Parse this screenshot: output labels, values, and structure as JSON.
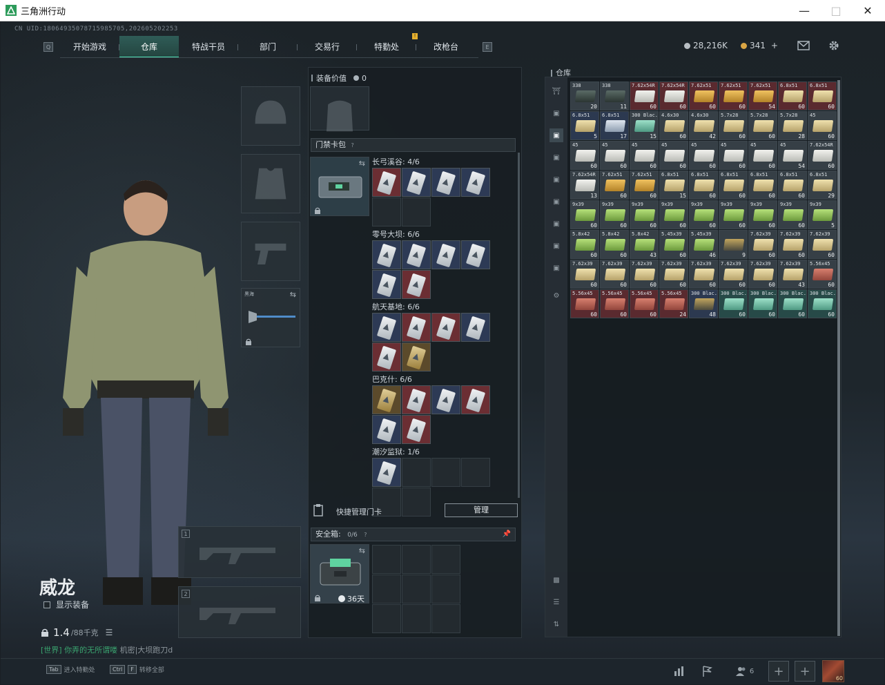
{
  "window": {
    "title": "三角洲行动",
    "controls": [
      "minimize",
      "maximize",
      "close"
    ]
  },
  "uid": "CN UID:18064935078715985705,202605202253",
  "nav": {
    "left_key": "Q",
    "right_key": "E",
    "tabs": [
      "开始游戏",
      "仓库",
      "特战干员",
      "部门",
      "交易行",
      "特勤处",
      "改枪台"
    ],
    "active": "仓库"
  },
  "currency": {
    "coins": "28,216K",
    "bonds": "341",
    "plus": "+"
  },
  "character": {
    "name": "威龙",
    "show_equipment": "显示装备",
    "weight_value": "1.4",
    "weight_max": "/88千克",
    "chat_channel": "[世界]",
    "chat_author": "你弄的无所谓喽",
    "chat_message": "机密|大坝跑刀d"
  },
  "equipment": {
    "melee_label": "黑海",
    "weapon_slot_1": "1",
    "weapon_slot_2": "2"
  },
  "gear_value": {
    "label": "装备价值",
    "value": "0"
  },
  "keycard_pack": {
    "title": "门禁卡包",
    "groups": [
      {
        "label": "长弓溪谷: 4/6",
        "cards": [
          "red",
          "navy",
          "navy",
          "navy",
          "empty",
          "empty"
        ]
      },
      {
        "label": "零号大坝: 6/6",
        "cards": [
          "navy",
          "navy",
          "navy",
          "navy",
          "navy",
          "red"
        ]
      },
      {
        "label": "航天基地: 6/6",
        "cards": [
          "navy",
          "red",
          "red",
          "navy",
          "red",
          "gold"
        ]
      },
      {
        "label": "巴克什: 6/6",
        "cards": [
          "gold",
          "red",
          "navy",
          "red",
          "navy",
          "red"
        ]
      },
      {
        "label": "潮汐监狱: 1/6",
        "cards": [
          "navy",
          "empty",
          "empty",
          "empty",
          "empty",
          "empty"
        ]
      }
    ],
    "quick_manage": "快捷管理门卡",
    "manage_button": "管理"
  },
  "safe_box": {
    "label": "安全箱:",
    "capacity": "0/6",
    "timer": "36天"
  },
  "warehouse": {
    "title": "仓库",
    "items": [
      {
        "cal": "338",
        "cnt": "20",
        "tile": "gray",
        "box": "dark"
      },
      {
        "cal": "338",
        "cnt": "11",
        "tile": "gray",
        "box": "dark"
      },
      {
        "cal": "7.62x54R",
        "cnt": "60",
        "tile": "red",
        "box": "white"
      },
      {
        "cal": "7.62x54R",
        "cnt": "60",
        "tile": "red",
        "box": "white"
      },
      {
        "cal": "7.62x51",
        "cnt": "60",
        "tile": "red",
        "box": "orange"
      },
      {
        "cal": "7.62x51",
        "cnt": "60",
        "tile": "red",
        "box": "orange"
      },
      {
        "cal": "7.62x51",
        "cnt": "54",
        "tile": "red",
        "box": "orange"
      },
      {
        "cal": "6.8x51",
        "cnt": "60",
        "tile": "red",
        "box": "tan"
      },
      {
        "cal": "6.8x51",
        "cnt": "60",
        "tile": "red",
        "box": "tan"
      },
      {
        "cal": "6.8x51",
        "cnt": "5",
        "tile": "navy",
        "box": "tan"
      },
      {
        "cal": "6.8x51",
        "cnt": "17",
        "tile": "navy",
        "box": "blue"
      },
      {
        "cal": "300 Blac.",
        "cnt": "15",
        "tile": "gray",
        "box": "teal"
      },
      {
        "cal": "4.6x30",
        "cnt": "60",
        "tile": "gray",
        "box": "tan"
      },
      {
        "cal": "4.6x30",
        "cnt": "42",
        "tile": "gray",
        "box": "tan"
      },
      {
        "cal": "5.7x28",
        "cnt": "60",
        "tile": "gray",
        "box": "tan"
      },
      {
        "cal": "5.7x28",
        "cnt": "60",
        "tile": "gray",
        "box": "tan"
      },
      {
        "cal": "5.7x28",
        "cnt": "28",
        "tile": "gray",
        "box": "tan"
      },
      {
        "cal": "45",
        "cnt": "60",
        "tile": "gray",
        "box": "tan"
      },
      {
        "cal": "45",
        "cnt": "60",
        "tile": "gray",
        "box": "white"
      },
      {
        "cal": "45",
        "cnt": "60",
        "tile": "gray",
        "box": "white"
      },
      {
        "cal": "45",
        "cnt": "60",
        "tile": "gray",
        "box": "white"
      },
      {
        "cal": "45",
        "cnt": "60",
        "tile": "gray",
        "box": "white"
      },
      {
        "cal": "45",
        "cnt": "60",
        "tile": "gray",
        "box": "white"
      },
      {
        "cal": "45",
        "cnt": "60",
        "tile": "gray",
        "box": "white"
      },
      {
        "cal": "45",
        "cnt": "60",
        "tile": "gray",
        "box": "white"
      },
      {
        "cal": "45",
        "cnt": "54",
        "tile": "gray",
        "box": "white"
      },
      {
        "cal": "7.62x54R",
        "cnt": "60",
        "tile": "gray",
        "box": "white"
      },
      {
        "cal": "7.62x54R",
        "cnt": "13",
        "tile": "gray",
        "box": "white"
      },
      {
        "cal": "7.62x51",
        "cnt": "60",
        "tile": "gray",
        "box": "orange"
      },
      {
        "cal": "7.62x51",
        "cnt": "60",
        "tile": "gray",
        "box": "orange"
      },
      {
        "cal": "6.8x51",
        "cnt": "15",
        "tile": "gray",
        "box": "tan"
      },
      {
        "cal": "6.8x51",
        "cnt": "60",
        "tile": "gray",
        "box": "tan"
      },
      {
        "cal": "6.8x51",
        "cnt": "60",
        "tile": "gray",
        "box": "tan"
      },
      {
        "cal": "6.8x51",
        "cnt": "60",
        "tile": "gray",
        "box": "tan"
      },
      {
        "cal": "6.8x51",
        "cnt": "60",
        "tile": "gray",
        "box": "tan"
      },
      {
        "cal": "6.8x51",
        "cnt": "29",
        "tile": "gray",
        "box": "tan"
      },
      {
        "cal": "9x39",
        "cnt": "60",
        "tile": "gray",
        "box": "green"
      },
      {
        "cal": "9x39",
        "cnt": "60",
        "tile": "gray",
        "box": "green"
      },
      {
        "cal": "9x39",
        "cnt": "60",
        "tile": "gray",
        "box": "green"
      },
      {
        "cal": "9x39",
        "cnt": "60",
        "tile": "gray",
        "box": "green"
      },
      {
        "cal": "9x39",
        "cnt": "60",
        "tile": "gray",
        "box": "green"
      },
      {
        "cal": "9x39",
        "cnt": "60",
        "tile": "gray",
        "box": "green"
      },
      {
        "cal": "9x39",
        "cnt": "60",
        "tile": "gray",
        "box": "green"
      },
      {
        "cal": "9x39",
        "cnt": "60",
        "tile": "gray",
        "box": "green"
      },
      {
        "cal": "9x39",
        "cnt": "5",
        "tile": "gray",
        "box": "green"
      },
      {
        "cal": "5.8x42",
        "cnt": "60",
        "tile": "gray",
        "box": "green"
      },
      {
        "cal": "5.8x42",
        "cnt": "60",
        "tile": "gray",
        "box": "green"
      },
      {
        "cal": "5.8x42",
        "cnt": "43",
        "tile": "gray",
        "box": "green"
      },
      {
        "cal": "5.45x39",
        "cnt": "60",
        "tile": "gray",
        "box": "green"
      },
      {
        "cal": "5.45x39",
        "cnt": "46",
        "tile": "gray",
        "box": "green"
      },
      {
        "cal": "",
        "cnt": "9",
        "tile": "gray",
        "box": "gun"
      },
      {
        "cal": "7.62x39",
        "cnt": "60",
        "tile": "gray",
        "box": "tan"
      },
      {
        "cal": "7.62x39",
        "cnt": "60",
        "tile": "gray",
        "box": "tan"
      },
      {
        "cal": "7.62x39",
        "cnt": "60",
        "tile": "gray",
        "box": "tan"
      },
      {
        "cal": "7.62x39",
        "cnt": "60",
        "tile": "gray",
        "box": "tan"
      },
      {
        "cal": "7.62x39",
        "cnt": "60",
        "tile": "gray",
        "box": "tan"
      },
      {
        "cal": "7.62x39",
        "cnt": "60",
        "tile": "gray",
        "box": "tan"
      },
      {
        "cal": "7.62x39",
        "cnt": "60",
        "tile": "gray",
        "box": "tan"
      },
      {
        "cal": "7.62x39",
        "cnt": "60",
        "tile": "gray",
        "box": "tan"
      },
      {
        "cal": "7.62x39",
        "cnt": "60",
        "tile": "gray",
        "box": "tan"
      },
      {
        "cal": "7.62x39",
        "cnt": "60",
        "tile": "gray",
        "box": "tan"
      },
      {
        "cal": "7.62x39",
        "cnt": "43",
        "tile": "gray",
        "box": "tan"
      },
      {
        "cal": "5.56x45",
        "cnt": "60",
        "tile": "gray",
        "box": "red"
      },
      {
        "cal": "5.56x45",
        "cnt": "60",
        "tile": "red",
        "box": "red"
      },
      {
        "cal": "5.56x45",
        "cnt": "60",
        "tile": "red",
        "box": "red"
      },
      {
        "cal": "5.56x45",
        "cnt": "60",
        "tile": "red",
        "box": "red"
      },
      {
        "cal": "5.56x45",
        "cnt": "24",
        "tile": "red",
        "box": "red"
      },
      {
        "cal": "300 Blac.",
        "cnt": "48",
        "tile": "navy",
        "box": "gun"
      },
      {
        "cal": "300 Blac.",
        "cnt": "60",
        "tile": "teal",
        "box": "teal"
      },
      {
        "cal": "300 Blac.",
        "cnt": "60",
        "tile": "teal",
        "box": "teal"
      },
      {
        "cal": "300 Blac.",
        "cnt": "60",
        "tile": "teal",
        "box": "teal"
      },
      {
        "cal": "300 Blac.",
        "cnt": "60",
        "tile": "teal",
        "box": "teal"
      }
    ]
  },
  "bottom": {
    "hint1_key": "Tab",
    "hint1_text": "进入特勤处",
    "hint2_key1": "Ctrl",
    "hint2_key2": "F",
    "hint2_text": "转移全部",
    "friends_count": "6",
    "player_level": "60"
  },
  "colors": {
    "accent": "#4fe0b5",
    "active_tab": "#2f5c57",
    "chat_green": "#3aa36f"
  }
}
